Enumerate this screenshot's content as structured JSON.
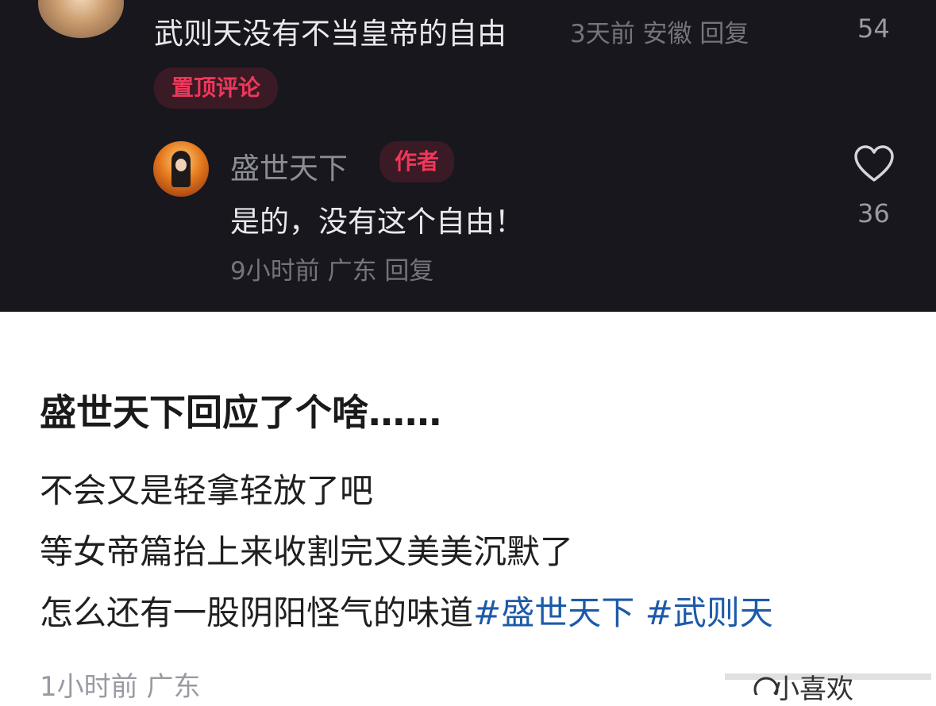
{
  "comment": {
    "text": "武则天没有不当皇帝的自由",
    "meta": "3天前 安徽 回复",
    "likes": "54",
    "pinned_label": "置顶评论"
  },
  "reply": {
    "username": "盛世天下",
    "badge": "作者",
    "text": "是的，没有这个自由！",
    "meta": "9小时前 广东 回复",
    "likes": "36"
  },
  "post": {
    "title": "盛世天下回应了个啥……",
    "lines": [
      "不会又是轻拿轻放了吧",
      "等女帝篇抬上来收割完又美美沉默了",
      "怎么还有一股阴阳怪气的味道"
    ],
    "hashtags": [
      "#盛世天下",
      "#武则天"
    ],
    "meta": "1小时前 广东"
  },
  "watermark": {
    "text": "小喜欢"
  },
  "colors": {
    "dark_bg": "#17171d",
    "accent_red": "#f0365a",
    "hashtag_blue": "#1d5aa8"
  }
}
